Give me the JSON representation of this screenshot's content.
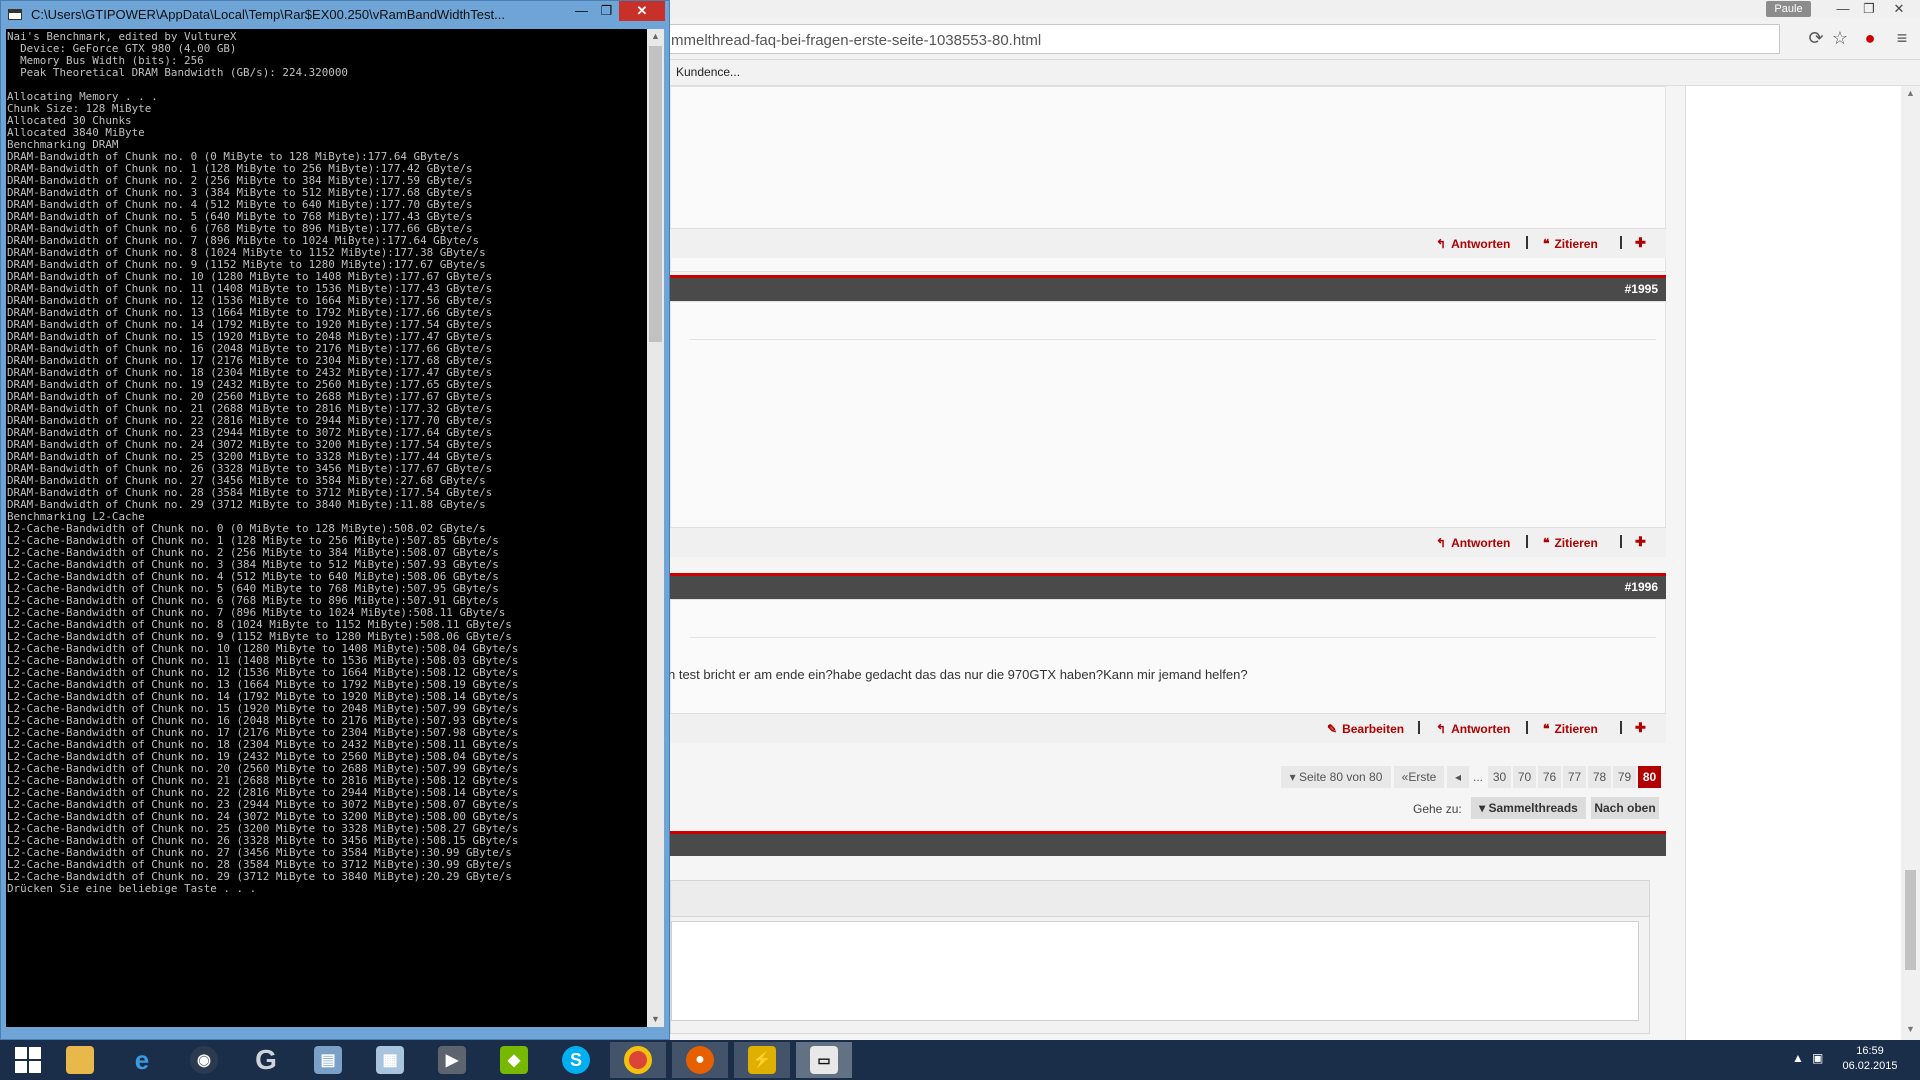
{
  "console": {
    "title": "C:\\Users\\GTIPOWER\\AppData\\Local\\Temp\\Rar$EX00.250\\vRamBandWidthTest...",
    "controls": {
      "minimize": "—",
      "maximize": "❐",
      "close": "✕"
    },
    "lines": [
      "Nai's Benchmark, edited by VultureX",
      "  Device: GeForce GTX 980 (4.00 GB)",
      "  Memory Bus Width (bits): 256",
      "  Peak Theoretical DRAM Bandwidth (GB/s): 224.320000",
      "",
      "Allocating Memory . . .",
      "Chunk Size: 128 MiByte",
      "Allocated 30 Chunks",
      "Allocated 3840 MiByte",
      "Benchmarking DRAM",
      "DRAM-Bandwidth of Chunk no. 0 (0 MiByte to 128 MiByte):177.64 GByte/s",
      "DRAM-Bandwidth of Chunk no. 1 (128 MiByte to 256 MiByte):177.42 GByte/s",
      "DRAM-Bandwidth of Chunk no. 2 (256 MiByte to 384 MiByte):177.59 GByte/s",
      "DRAM-Bandwidth of Chunk no. 3 (384 MiByte to 512 MiByte):177.68 GByte/s",
      "DRAM-Bandwidth of Chunk no. 4 (512 MiByte to 640 MiByte):177.70 GByte/s",
      "DRAM-Bandwidth of Chunk no. 5 (640 MiByte to 768 MiByte):177.43 GByte/s",
      "DRAM-Bandwidth of Chunk no. 6 (768 MiByte to 896 MiByte):177.66 GByte/s",
      "DRAM-Bandwidth of Chunk no. 7 (896 MiByte to 1024 MiByte):177.64 GByte/s",
      "DRAM-Bandwidth of Chunk no. 8 (1024 MiByte to 1152 MiByte):177.38 GByte/s",
      "DRAM-Bandwidth of Chunk no. 9 (1152 MiByte to 1280 MiByte):177.67 GByte/s",
      "DRAM-Bandwidth of Chunk no. 10 (1280 MiByte to 1408 MiByte):177.67 GByte/s",
      "DRAM-Bandwidth of Chunk no. 11 (1408 MiByte to 1536 MiByte):177.43 GByte/s",
      "DRAM-Bandwidth of Chunk no. 12 (1536 MiByte to 1664 MiByte):177.56 GByte/s",
      "DRAM-Bandwidth of Chunk no. 13 (1664 MiByte to 1792 MiByte):177.66 GByte/s",
      "DRAM-Bandwidth of Chunk no. 14 (1792 MiByte to 1920 MiByte):177.54 GByte/s",
      "DRAM-Bandwidth of Chunk no. 15 (1920 MiByte to 2048 MiByte):177.47 GByte/s",
      "DRAM-Bandwidth of Chunk no. 16 (2048 MiByte to 2176 MiByte):177.66 GByte/s",
      "DRAM-Bandwidth of Chunk no. 17 (2176 MiByte to 2304 MiByte):177.68 GByte/s",
      "DRAM-Bandwidth of Chunk no. 18 (2304 MiByte to 2432 MiByte):177.47 GByte/s",
      "DRAM-Bandwidth of Chunk no. 19 (2432 MiByte to 2560 MiByte):177.65 GByte/s",
      "DRAM-Bandwidth of Chunk no. 20 (2560 MiByte to 2688 MiByte):177.67 GByte/s",
      "DRAM-Bandwidth of Chunk no. 21 (2688 MiByte to 2816 MiByte):177.32 GByte/s",
      "DRAM-Bandwidth of Chunk no. 22 (2816 MiByte to 2944 MiByte):177.70 GByte/s",
      "DRAM-Bandwidth of Chunk no. 23 (2944 MiByte to 3072 MiByte):177.64 GByte/s",
      "DRAM-Bandwidth of Chunk no. 24 (3072 MiByte to 3200 MiByte):177.54 GByte/s",
      "DRAM-Bandwidth of Chunk no. 25 (3200 MiByte to 3328 MiByte):177.44 GByte/s",
      "DRAM-Bandwidth of Chunk no. 26 (3328 MiByte to 3456 MiByte):177.67 GByte/s",
      "DRAM-Bandwidth of Chunk no. 27 (3456 MiByte to 3584 MiByte):27.68 GByte/s",
      "DRAM-Bandwidth of Chunk no. 28 (3584 MiByte to 3712 MiByte):177.54 GByte/s",
      "DRAM-Bandwidth of Chunk no. 29 (3712 MiByte to 3840 MiByte):11.88 GByte/s",
      "Benchmarking L2-Cache",
      "L2-Cache-Bandwidth of Chunk no. 0 (0 MiByte to 128 MiByte):508.02 GByte/s",
      "L2-Cache-Bandwidth of Chunk no. 1 (128 MiByte to 256 MiByte):507.85 GByte/s",
      "L2-Cache-Bandwidth of Chunk no. 2 (256 MiByte to 384 MiByte):508.07 GByte/s",
      "L2-Cache-Bandwidth of Chunk no. 3 (384 MiByte to 512 MiByte):507.93 GByte/s",
      "L2-Cache-Bandwidth of Chunk no. 4 (512 MiByte to 640 MiByte):508.06 GByte/s",
      "L2-Cache-Bandwidth of Chunk no. 5 (640 MiByte to 768 MiByte):507.95 GByte/s",
      "L2-Cache-Bandwidth of Chunk no. 6 (768 MiByte to 896 MiByte):507.91 GByte/s",
      "L2-Cache-Bandwidth of Chunk no. 7 (896 MiByte to 1024 MiByte):508.11 GByte/s",
      "L2-Cache-Bandwidth of Chunk no. 8 (1024 MiByte to 1152 MiByte):508.11 GByte/s",
      "L2-Cache-Bandwidth of Chunk no. 9 (1152 MiByte to 1280 MiByte):508.06 GByte/s",
      "L2-Cache-Bandwidth of Chunk no. 10 (1280 MiByte to 1408 MiByte):508.04 GByte/s",
      "L2-Cache-Bandwidth of Chunk no. 11 (1408 MiByte to 1536 MiByte):508.03 GByte/s",
      "L2-Cache-Bandwidth of Chunk no. 12 (1536 MiByte to 1664 MiByte):508.12 GByte/s",
      "L2-Cache-Bandwidth of Chunk no. 13 (1664 MiByte to 1792 MiByte):508.19 GByte/s",
      "L2-Cache-Bandwidth of Chunk no. 14 (1792 MiByte to 1920 MiByte):508.14 GByte/s",
      "L2-Cache-Bandwidth of Chunk no. 15 (1920 MiByte to 2048 MiByte):507.99 GByte/s",
      "L2-Cache-Bandwidth of Chunk no. 16 (2048 MiByte to 2176 MiByte):507.93 GByte/s",
      "L2-Cache-Bandwidth of Chunk no. 17 (2176 MiByte to 2304 MiByte):507.98 GByte/s",
      "L2-Cache-Bandwidth of Chunk no. 18 (2304 MiByte to 2432 MiByte):508.11 GByte/s",
      "L2-Cache-Bandwidth of Chunk no. 19 (2432 MiByte to 2560 MiByte):508.04 GByte/s",
      "L2-Cache-Bandwidth of Chunk no. 20 (2560 MiByte to 2688 MiByte):507.99 GByte/s",
      "L2-Cache-Bandwidth of Chunk no. 21 (2688 MiByte to 2816 MiByte):508.12 GByte/s",
      "L2-Cache-Bandwidth of Chunk no. 22 (2816 MiByte to 2944 MiByte):508.14 GByte/s",
      "L2-Cache-Bandwidth of Chunk no. 23 (2944 MiByte to 3072 MiByte):508.07 GByte/s",
      "L2-Cache-Bandwidth of Chunk no. 24 (3072 MiByte to 3200 MiByte):508.00 GByte/s",
      "L2-Cache-Bandwidth of Chunk no. 25 (3200 MiByte to 3328 MiByte):508.27 GByte/s",
      "L2-Cache-Bandwidth of Chunk no. 26 (3328 MiByte to 3456 MiByte):508.15 GByte/s",
      "L2-Cache-Bandwidth of Chunk no. 27 (3456 MiByte to 3584 MiByte):30.99 GByte/s",
      "L2-Cache-Bandwidth of Chunk no. 28 (3584 MiByte to 3712 MiByte):30.99 GByte/s",
      "L2-Cache-Bandwidth of Chunk no. 29 (3712 MiByte to 3840 MiByte):20.29 GByte/s",
      "Drücken Sie eine beliebige Taste . . ."
    ]
  },
  "browser": {
    "profile": "Paule",
    "url": "mmelthread-faq-bei-fragen-erste-seite-1038553-80.html",
    "bookmark": "Kundence...",
    "icons": {
      "reload": "⟳",
      "star": "☆",
      "extension": "●",
      "menu": "≡"
    }
  },
  "forum": {
    "actions": {
      "edit": "Bearbeiten",
      "reply": "Antworten",
      "quote": "Zitieren",
      "multiquote": "✚"
    },
    "post_numbers": [
      "#1995",
      "#1996"
    ],
    "post_text": "n test bricht er am ende ein?habe gedacht das das nur die 970GTX haben?Kann mir jemand helfen?",
    "pagination": {
      "info": "Seite 80 von 80",
      "first": "Erste",
      "prev": "◂",
      "ellipsis": "...",
      "pages": [
        "30",
        "70",
        "76",
        "77",
        "78",
        "79",
        "80"
      ],
      "current": "80"
    },
    "goto": {
      "label": "Gehe zu:",
      "dropdown": "Sammelthreads",
      "top": "Nach oben"
    }
  },
  "taskbar": {
    "apps": [
      "start",
      "file-explorer",
      "internet-explorer",
      "steam",
      "g-launcher",
      "network-app",
      "calculator",
      "media-app",
      "nvidia",
      "skype",
      "chrome",
      "firefox",
      "gpu-tool",
      "console"
    ],
    "time": "16:59",
    "date": "06.02.2015"
  }
}
